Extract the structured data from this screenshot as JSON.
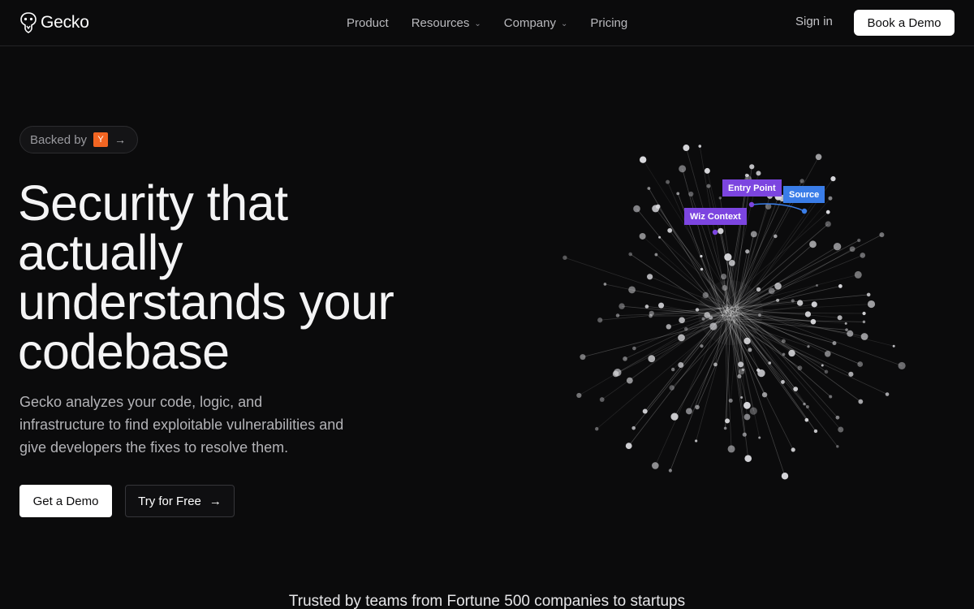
{
  "brand": {
    "name": "Gecko",
    "icon": "gecko-logo-icon"
  },
  "nav": {
    "items": [
      {
        "label": "Product",
        "dropdown": false
      },
      {
        "label": "Resources",
        "dropdown": true
      },
      {
        "label": "Company",
        "dropdown": true
      },
      {
        "label": "Pricing",
        "dropdown": false
      }
    ],
    "sign_in": "Sign in",
    "book_demo": "Book a Demo"
  },
  "hero": {
    "badge": {
      "text": "Backed by",
      "logo_text": "Y",
      "logo_color": "#f26522"
    },
    "headline": "Security that actually understands your codebase",
    "subtext": "Gecko analyzes your code, logic, and infrastructure to find exploitable vulnerabilities and give developers the fixes to resolve them.",
    "cta_primary": "Get a Demo",
    "cta_secondary": "Try for Free"
  },
  "graph": {
    "labels": {
      "entry_point": "Entry Point",
      "source": "Source",
      "wiz_context": "Wiz Context"
    },
    "colors": {
      "purple": "#7c45e0",
      "blue": "#3a7de8",
      "node": "#d8d8dc"
    }
  },
  "trusted": "Trusted by teams from Fortune 500 companies to startups",
  "colors": {
    "background": "#0b0b0c",
    "text": "#ffffff",
    "muted": "#b3b3b7"
  }
}
